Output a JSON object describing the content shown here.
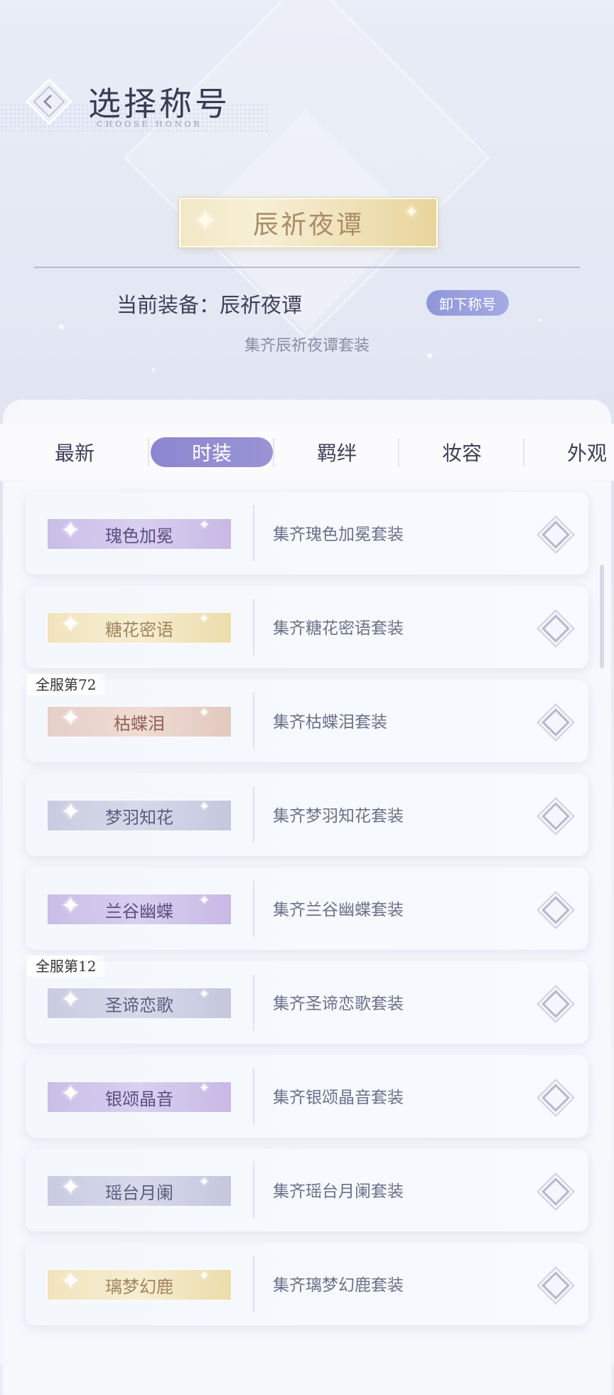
{
  "header": {
    "title": "选择称号",
    "subtitle": "CHOOSE HONOR"
  },
  "showcase": {
    "title_badge": "辰祈夜谭",
    "current_label": "当前装备：辰祈夜谭",
    "unequip_label": "卸下称号",
    "condition": "集齐辰祈夜谭套装"
  },
  "tabs": [
    "最新",
    "时装",
    "羁绊",
    "妆容",
    "外观"
  ],
  "active_tab": "时装",
  "titles": [
    {
      "name": "瑰色加冕",
      "condition": "集齐瑰色加冕套装",
      "style": "purple",
      "rank": ""
    },
    {
      "name": "糖花密语",
      "condition": "集齐糖花密语套装",
      "style": "gold",
      "rank": ""
    },
    {
      "name": "枯蝶泪",
      "condition": "集齐枯蝶泪套装",
      "style": "rose",
      "rank": "全服第72"
    },
    {
      "name": "梦羽知花",
      "condition": "集齐梦羽知花套装",
      "style": "silver",
      "rank": ""
    },
    {
      "name": "兰谷幽蝶",
      "condition": "集齐兰谷幽蝶套装",
      "style": "purple",
      "rank": ""
    },
    {
      "name": "圣谛恋歌",
      "condition": "集齐圣谛恋歌套装",
      "style": "silver",
      "rank": "全服第12"
    },
    {
      "name": "银颂晶音",
      "condition": "集齐银颂晶音套装",
      "style": "purple",
      "rank": ""
    },
    {
      "name": "瑶台月阑",
      "condition": "集齐瑶台月阑套装",
      "style": "silver",
      "rank": ""
    },
    {
      "name": "璃梦幻鹿",
      "condition": "集齐璃梦幻鹿套装",
      "style": "gold",
      "rank": ""
    }
  ]
}
